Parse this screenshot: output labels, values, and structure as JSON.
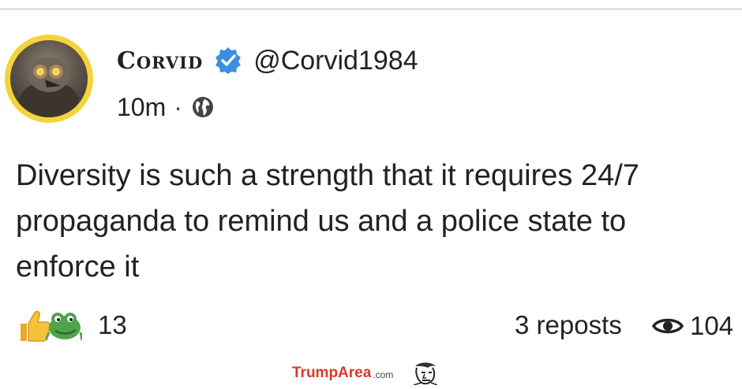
{
  "post": {
    "author": {
      "display_name": "Corvid",
      "handle": "@Corvid1984",
      "verified": true,
      "avatar_ring_color": "#f4d23a",
      "verified_color": "#3b8fe0"
    },
    "timestamp": "10m",
    "separator": "·",
    "visibility_icon": "globe-icon",
    "text": "Diversity is such a strength that it requires 24/7 propaganda to remind us and a police state to enforce it",
    "reactions": {
      "icons": [
        "thumbs-up-icon",
        "frog-icon"
      ],
      "count": "13"
    },
    "reposts": "3 reposts",
    "views": {
      "icon": "eye-icon",
      "count": "104"
    }
  },
  "watermark": {
    "brand": "TrumpArea",
    "tld": ".com",
    "brand_color": "#d63a2a"
  }
}
